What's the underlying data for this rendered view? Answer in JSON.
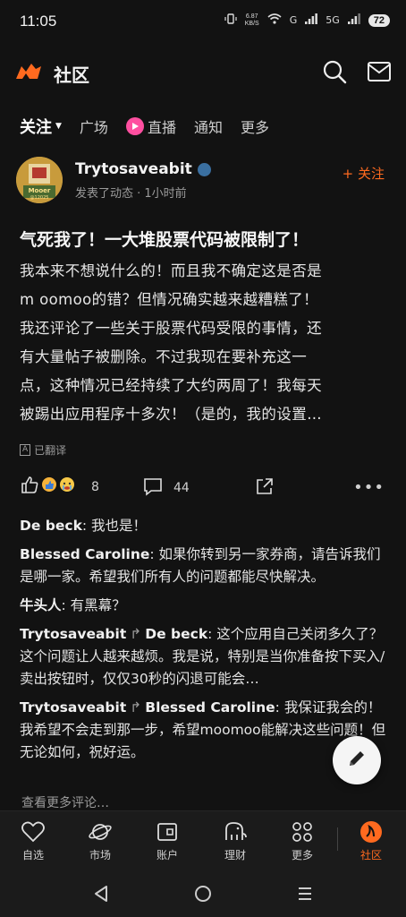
{
  "status_bar": {
    "time": "11:05",
    "net_speed_value": "6.87",
    "net_speed_unit": "KB/S",
    "signal_1": "G",
    "signal_2": "5G",
    "battery": "72"
  },
  "header": {
    "title": "社区",
    "logo_icon": "bull-logo-icon",
    "search_icon": "search-icon",
    "mail_icon": "mail-icon"
  },
  "tabs": [
    {
      "label": "关注",
      "active": true
    },
    {
      "label": "广场"
    },
    {
      "label": "直播"
    },
    {
      "label": "通知"
    },
    {
      "label": "更多"
    }
  ],
  "post": {
    "author": "Trytosaveabit",
    "avatar_text": "Mooer",
    "avatar_sub": "@12025",
    "meta": "发表了动态 · 1小时前",
    "follow_label": "+ 关注",
    "title": "气死我了！一大堆股票代码被限制了！",
    "body_lines": [
      "我本来不想说什么的！而且我不确定这是否是",
      "m oomoo的错？但情况确实越来越糟糕了！",
      "我还评论了一些关于股票代码受限的事情，还",
      "有大量帖子被删除。不过我现在要补充这一",
      "点，这种情况已经持续了大约两周了！我每天",
      "被踢出应用程序十多次！（是的，我的设置…"
    ],
    "translated_badge": "A",
    "translated_label": "已翻译",
    "reaction_count": "8",
    "comment_count": "44"
  },
  "comments": [
    {
      "name": "De beck",
      "text": ": 我也是！"
    },
    {
      "name": "Blessed Caroline",
      "text": ": 如果你转到另一家券商，请告诉我们是哪一家。希望我们所有人的问题都能尽快解决。"
    },
    {
      "name": "牛头人",
      "text": ": 有黑幕？"
    },
    {
      "name": "Trytosaveabit",
      "reply_to": "De beck",
      "text": ": 这个应用自己关闭多久了？这个问题让人越来越烦。我是说，特别是当你准备按下买入/卖出按钮时，仅仅30秒的闪退可能会…"
    },
    {
      "name": "Trytosaveabit",
      "reply_to": "Blessed Caroline",
      "text": ": 我保证我会的！我希望不会走到那一步，希望moomoo能解决这些问题！但无论如何，祝好运。"
    }
  ],
  "more_comments_label": "查看更多评论…",
  "bottom_nav": [
    {
      "label": "自选",
      "icon": "heart-icon"
    },
    {
      "label": "市场",
      "icon": "planet-icon"
    },
    {
      "label": "账户",
      "icon": "wallet-icon"
    },
    {
      "label": "理财",
      "icon": "elephant-icon"
    },
    {
      "label": "更多",
      "icon": "grid-icon"
    },
    {
      "label": "社区",
      "icon": "community-icon",
      "active": true
    }
  ],
  "colors": {
    "accent": "#ff6a1f",
    "background": "#121212",
    "live": "#ff4fa0"
  }
}
